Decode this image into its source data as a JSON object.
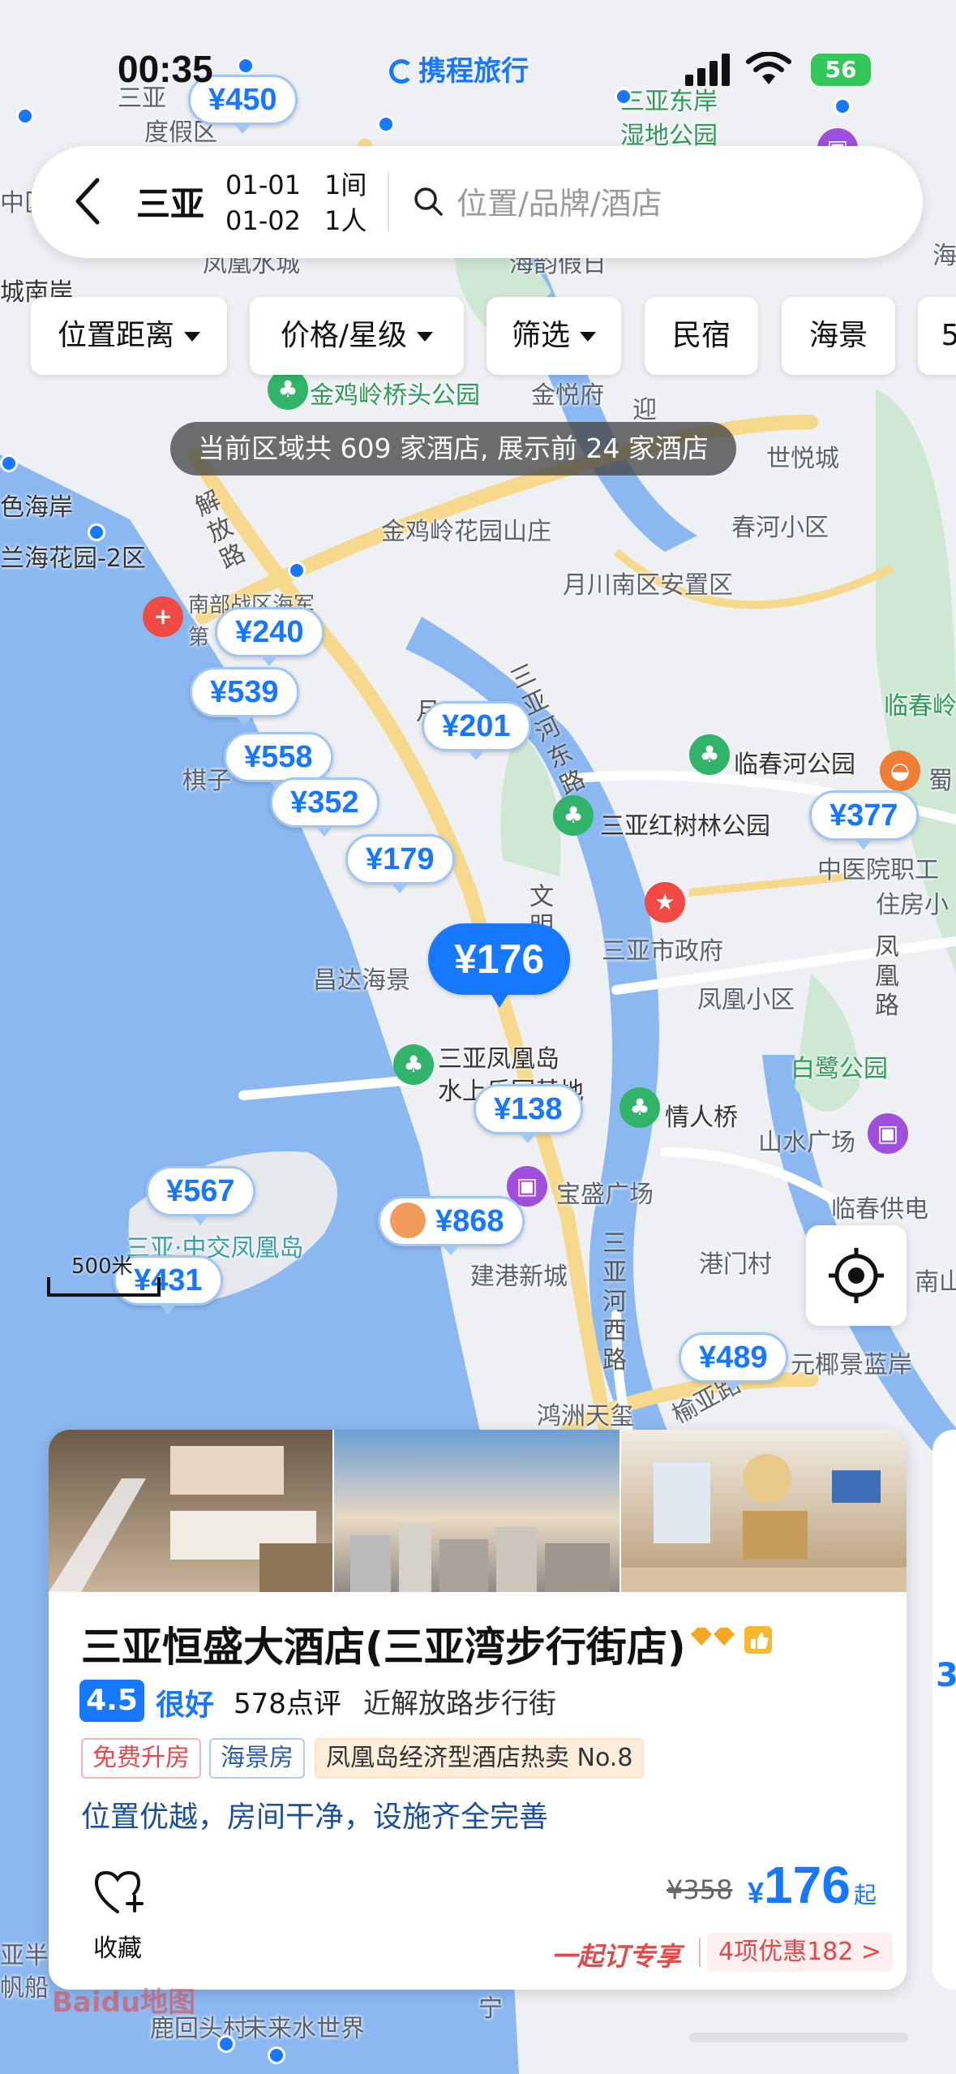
{
  "status_bar": {
    "time": "00:35",
    "carrier_logo": "携程旅行",
    "battery": "56"
  },
  "search": {
    "city": "三亚",
    "checkin": "01-01",
    "checkout": "01-02",
    "rooms": "1间",
    "guests": "1人",
    "placeholder": "位置/品牌/酒店"
  },
  "filters": [
    "位置距离",
    "价格/星级",
    "筛选",
    "民宿",
    "海景",
    "5"
  ],
  "notice": "当前区域共 609 家酒店, 展示前 24 家酒店",
  "map": {
    "price_pins": [
      "¥450",
      "¥176",
      "¥240",
      "¥539",
      "¥558",
      "¥352",
      "¥179",
      "¥201",
      "¥377",
      "¥138",
      "¥868",
      "¥567",
      "¥431",
      "¥489"
    ],
    "selected_pin": "¥176",
    "labels": [
      "三亚东岸",
      "湿地公园",
      "三亚",
      "度假区",
      "中区",
      "海",
      "海韵假日",
      "凤凰水城",
      "城南岸",
      "世悦城",
      "金鸡岭桥头公园",
      "金悦府",
      "迎",
      "色海岸",
      "兰海花园-2区",
      "金鸡岭花园山庄",
      "春河小区",
      "月川南区安置区",
      "南部战区海军",
      "第",
      "临春岭",
      "棋子",
      "临春河公园",
      "蜀",
      "三亚红树林公园",
      "中医院职工",
      "住房小",
      "三亚市政府",
      "昌达海景",
      "凤凰小区",
      "三亚凤凰岛",
      "水上乐园基地",
      "白鹭公园",
      "情人桥",
      "山水广场",
      "宝盛广场",
      "临春供电",
      "港门村",
      "南山",
      "三亚·中交凤凰岛",
      "建港新城",
      "元椰景蓝岸",
      "鸿洲天玺",
      "榆亚路",
      "鹿回头村",
      "未来水世界",
      "宁",
      "亚半山",
      "帆船"
    ],
    "vertical_labels": [
      "解放路",
      "三亚河东路",
      "文明",
      "凤凰路",
      "三亚河西路",
      "月"
    ],
    "scale": "500米",
    "watermark": "Baidu地图"
  },
  "hotel_card": {
    "name": "三亚恒盛大酒店(三亚湾步行街店)",
    "score": "4.5",
    "score_word": "很好",
    "reviews": "578点评",
    "nearby": "近解放路步行街",
    "tags": [
      "免费升房",
      "海景房",
      "凤凰岛经济型酒店热卖 No.8"
    ],
    "description": "位置优越，房间干净，设施齐全完善",
    "favorite_label": "收藏",
    "price_original": "¥358",
    "price_symbol": "¥",
    "price_current": "176",
    "price_suffix": "起",
    "promo": "一起订专享",
    "offers": "4项优惠182 >",
    "next_card_peek": "3"
  },
  "colors": {
    "brand_blue": "#1677ff",
    "promo_red": "#e14a4a",
    "park_green": "#32b36a",
    "water": "#8bb8f1"
  }
}
